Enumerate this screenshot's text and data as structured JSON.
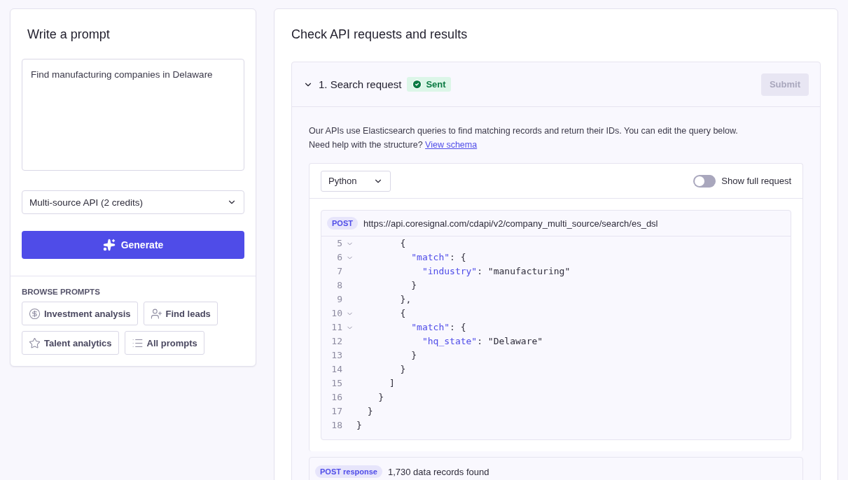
{
  "prompt_panel": {
    "title": "Write a prompt",
    "prompt_text": "Find manufacturing companies in Delaware",
    "api_select": "Multi-source API (2 credits)",
    "generate_button": "Generate",
    "browse_heading": "BROWSE PROMPTS",
    "prompt_chips": [
      {
        "kind": "dollar",
        "label": "Investment analysis"
      },
      {
        "kind": "person",
        "label": "Find leads"
      },
      {
        "kind": "star",
        "label": "Talent analytics"
      },
      {
        "kind": "list",
        "label": "All prompts"
      }
    ]
  },
  "results_panel": {
    "title": "Check API requests and results",
    "section": {
      "title": "1. Search request",
      "expanded": true,
      "status": "Sent",
      "submit_button": "Submit",
      "submit_disabled": true,
      "description": "Our APIs use Elasticsearch queries to find matching records and return their IDs. You can edit the query below.",
      "help_text": "Need help with the structure?",
      "help_link": "View schema",
      "language_select": "Python",
      "show_full_request": {
        "label": "Show full request",
        "on": false
      },
      "method": "POST",
      "url": "https://api.coresignal.com/cdapi/v2/company_multi_source/search/es_dsl",
      "code_lines": [
        {
          "num": "5",
          "foldable": true,
          "tokens": [
            {
              "kind": "plain",
              "text": "        {"
            }
          ]
        },
        {
          "num": "6",
          "foldable": true,
          "tokens": [
            {
              "kind": "key",
              "text": "          \"match\""
            },
            {
              "kind": "plain",
              "text": ": {"
            }
          ]
        },
        {
          "num": "7",
          "foldable": false,
          "tokens": [
            {
              "kind": "key",
              "text": "            \"industry\""
            },
            {
              "kind": "plain",
              "text": ": \"manufacturing\""
            }
          ]
        },
        {
          "num": "8",
          "foldable": false,
          "tokens": [
            {
              "kind": "plain",
              "text": "          }"
            }
          ]
        },
        {
          "num": "9",
          "foldable": false,
          "tokens": [
            {
              "kind": "plain",
              "text": "        },"
            }
          ]
        },
        {
          "num": "10",
          "foldable": true,
          "tokens": [
            {
              "kind": "plain",
              "text": "        {"
            }
          ]
        },
        {
          "num": "11",
          "foldable": true,
          "tokens": [
            {
              "kind": "key",
              "text": "          \"match\""
            },
            {
              "kind": "plain",
              "text": ": {"
            }
          ]
        },
        {
          "num": "12",
          "foldable": false,
          "tokens": [
            {
              "kind": "key",
              "text": "            \"hq_state\""
            },
            {
              "kind": "plain",
              "text": ": \"Delaware\""
            }
          ]
        },
        {
          "num": "13",
          "foldable": false,
          "tokens": [
            {
              "kind": "plain",
              "text": "          }"
            }
          ]
        },
        {
          "num": "14",
          "foldable": false,
          "tokens": [
            {
              "kind": "plain",
              "text": "        }"
            }
          ]
        },
        {
          "num": "15",
          "foldable": false,
          "tokens": [
            {
              "kind": "plain",
              "text": "      ]"
            }
          ]
        },
        {
          "num": "16",
          "foldable": false,
          "tokens": [
            {
              "kind": "plain",
              "text": "    }"
            }
          ]
        },
        {
          "num": "17",
          "foldable": false,
          "tokens": [
            {
              "kind": "plain",
              "text": "  }"
            }
          ]
        },
        {
          "num": "18",
          "foldable": false,
          "tokens": [
            {
              "kind": "plain",
              "text": "}"
            }
          ]
        }
      ],
      "response_badge": "POST response",
      "response_text": "1,730 data records found"
    }
  }
}
